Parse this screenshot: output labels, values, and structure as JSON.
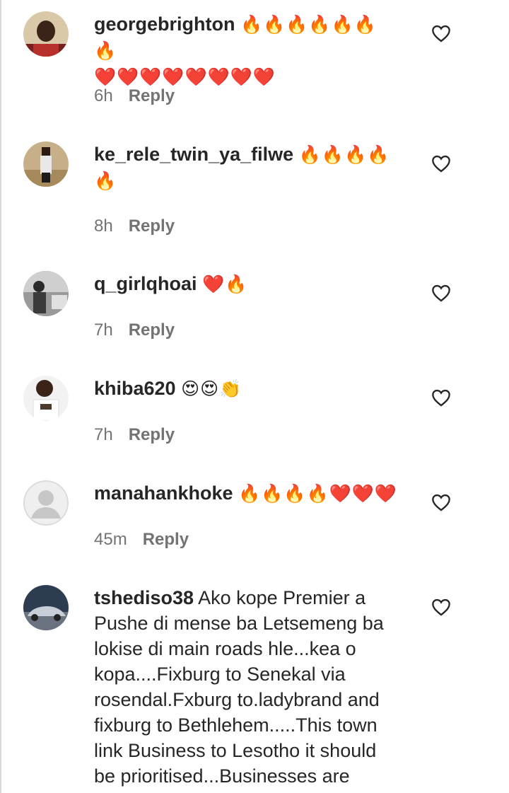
{
  "comments": [
    {
      "username": "georgebrighton",
      "text": "",
      "emoji_line1": "🔥🔥🔥🔥🔥🔥🔥",
      "emoji_line2": "❤️❤️❤️❤️❤️❤️❤️❤️",
      "time": "6h",
      "reply_label": "Reply"
    },
    {
      "username": "ke_rele_twin_ya_filwe",
      "text": "",
      "emoji_line1": "🔥🔥🔥🔥",
      "emoji_line2": "🔥",
      "time": "8h",
      "reply_label": "Reply"
    },
    {
      "username": "q_girlqhoai",
      "text": "",
      "emoji_line1": "❤️🔥",
      "time": "7h",
      "reply_label": "Reply"
    },
    {
      "username": "khiba620",
      "text": "",
      "emoji_line1": "😍😍👏",
      "time": "7h",
      "reply_label": "Reply"
    },
    {
      "username": "manahankhoke",
      "text": "",
      "emoji_line1": "🔥🔥🔥🔥❤️❤️❤️",
      "time": "45m",
      "reply_label": "Reply"
    },
    {
      "username": "tshediso38",
      "text": "Ako kope Premier a Pushe di mense ba Letsemeng ba lokise di main roads hle...kea o kopa....Fixburg to Senekal via rosendal.Fxburg to.ladybrand and fixburg to Bethlehem.....This town link Business to Lesotho it should be prioritised...Businesses are"
    }
  ],
  "colors": {
    "text": "#262626",
    "secondary": "#737373",
    "fire": "#f4900c",
    "heart": "#dd2e44"
  },
  "icons": {
    "like": "heart-outline-icon",
    "avatar_default": "default-avatar-icon"
  }
}
